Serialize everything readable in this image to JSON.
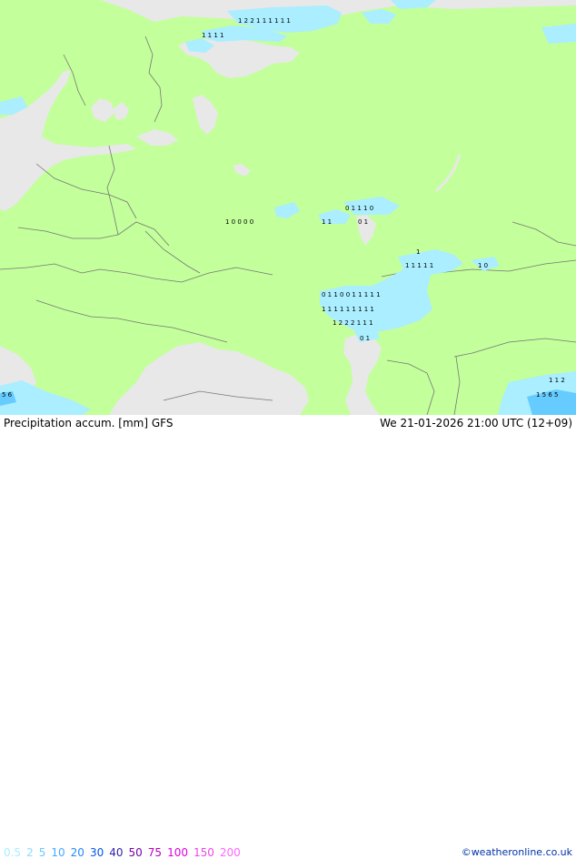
{
  "footer": {
    "title": "Precipitation accum. [mm] GFS",
    "datetime": "We 21-01-2026 21:00 UTC (12+09)",
    "credit": "©weatheronline.co.uk"
  },
  "legend": {
    "values": [
      "0.5",
      "2",
      "5",
      "10",
      "20",
      "30",
      "40",
      "50",
      "75",
      "100",
      "150",
      "200"
    ],
    "colors": [
      "#aaeeff",
      "#88ddff",
      "#66ccff",
      "#44aaff",
      "#2288ff",
      "#0055ee",
      "#3322aa",
      "#7700aa",
      "#bb00bb",
      "#dd00dd",
      "#ee44ee",
      "#ff66ff"
    ]
  },
  "map_colors": {
    "land": "#c3ff9b",
    "sea": "#e8e8e8",
    "precip_light": "#aaeeff",
    "precip_medium": "#66ccff"
  },
  "labels": {
    "row_north": "1 2 2 1 1 1 1 1 1",
    "row_nw": "1 1 1 1",
    "mid_row": "1 0 0 0 0",
    "row_d": "0 1 1 1 0",
    "row_g": "1 1",
    "row_h": "0 1",
    "east_row1": "1 1 1 1 1",
    "east_row2": "0 1 1 0 0 1 1 1 1 1",
    "east_row3": "1 1 1 1 1 1 1 1 1",
    "east_row4": "1 2 2 2 1 1 1",
    "east_pair": "1 0",
    "east_single": "1",
    "lower": "0 1",
    "se_a": "1 1 2",
    "se_b": "1 5 6 5",
    "sw_a": "5 6"
  }
}
